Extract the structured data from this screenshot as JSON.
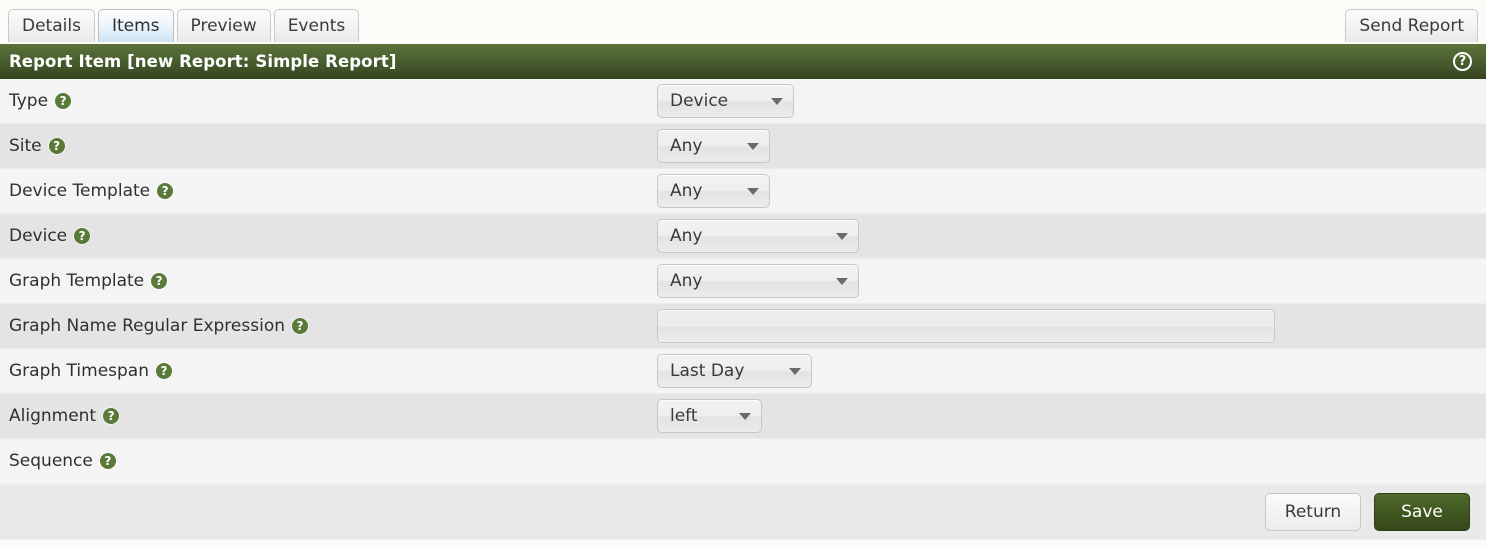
{
  "tabs": [
    {
      "label": "Details",
      "active": false
    },
    {
      "label": "Items",
      "active": true
    },
    {
      "label": "Preview",
      "active": false
    },
    {
      "label": "Events",
      "active": false
    }
  ],
  "toolbar": {
    "send_report_label": "Send Report"
  },
  "panel": {
    "title": "Report Item [new Report: Simple Report]",
    "help_icon": "question-circle-icon",
    "help_glyph": "?",
    "accent_color": "#4a6030"
  },
  "form": {
    "rows": [
      {
        "label": "Type",
        "control": "select",
        "value": "Device",
        "width_class": "w-type",
        "name": "type"
      },
      {
        "label": "Site",
        "control": "select",
        "value": "Any",
        "width_class": "w-site",
        "name": "site"
      },
      {
        "label": "Device Template",
        "control": "select",
        "value": "Any",
        "width_class": "w-devtpl",
        "name": "device-template"
      },
      {
        "label": "Device",
        "control": "select",
        "value": "Any",
        "width_class": "w-dev",
        "name": "device"
      },
      {
        "label": "Graph Template",
        "control": "select",
        "value": "Any",
        "width_class": "w-gtpl",
        "name": "graph-template"
      },
      {
        "label": "Graph Name Regular Expression",
        "control": "text",
        "value": "",
        "placeholder": "",
        "name": "graph-name-regex"
      },
      {
        "label": "Graph Timespan",
        "control": "select",
        "value": "Last Day",
        "width_class": "w-span",
        "name": "graph-timespan"
      },
      {
        "label": "Alignment",
        "control": "select",
        "value": "left",
        "width_class": "w-align",
        "name": "alignment"
      },
      {
        "label": "Sequence",
        "control": "none",
        "value": "",
        "name": "sequence"
      }
    ],
    "help_glyph": "?"
  },
  "footer": {
    "return_label": "Return",
    "save_label": "Save"
  }
}
